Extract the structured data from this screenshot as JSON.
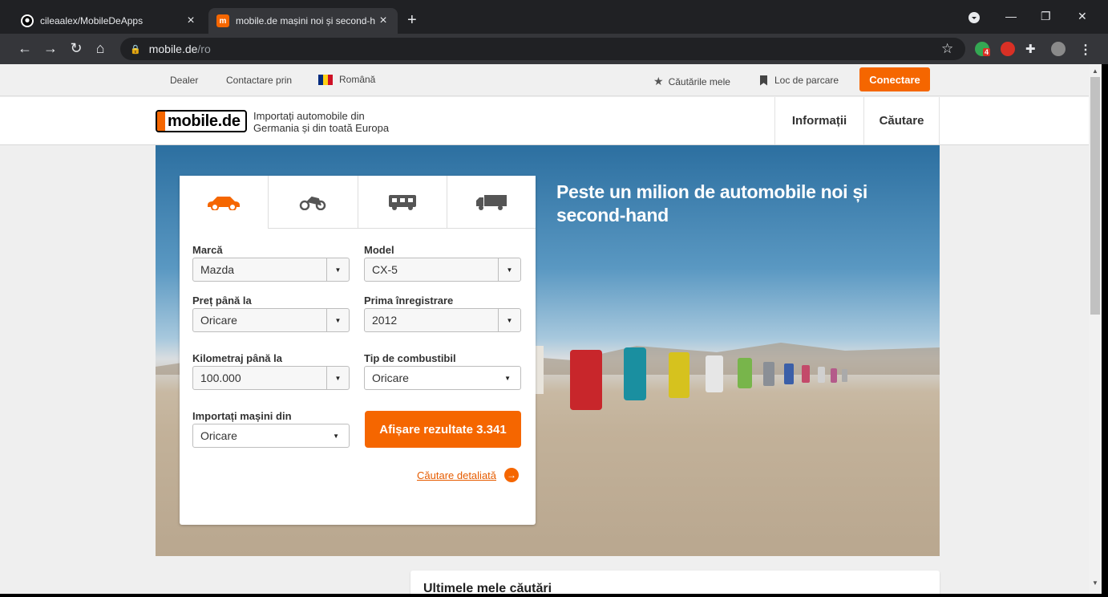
{
  "browser": {
    "tabs": [
      {
        "title": "cileaalex/MobileDeApps",
        "active": false
      },
      {
        "title": "mobile.de mașini noi și second-h",
        "active": true
      }
    ],
    "url_host": "mobile.de",
    "url_path": "/ro",
    "extension_badge": "4"
  },
  "utility_bar": {
    "dealer": "Dealer",
    "contact": "Contactare prin",
    "language": "Română",
    "saved_searches": "Căutările mele",
    "parking": "Loc de parcare",
    "login": "Conectare"
  },
  "header": {
    "logo": "mobile.de",
    "tagline_line1": "Importați automobile din",
    "tagline_line2": "Germania și din toată Europa",
    "nav_info": "Informații",
    "nav_search": "Căutare"
  },
  "hero": {
    "title_line1": "Peste un milion de automobile noi și",
    "title_line2": "second-hand"
  },
  "search_form": {
    "make_label": "Marcă",
    "make_value": "Mazda",
    "model_label": "Model",
    "model_value": "CX-5",
    "price_label": "Preț până la",
    "price_value": "Oricare",
    "reg_label": "Prima înregistrare",
    "reg_value": "2012",
    "mileage_label": "Kilometraj până la",
    "mileage_value": "100.000",
    "fuel_label": "Tip de combustibil",
    "fuel_value": "Oricare",
    "import_label": "Importați mașini din",
    "import_value": "Oricare",
    "submit": "Afișare rezultate 3.341",
    "advanced": "Căutare detaliată"
  },
  "recent_searches": {
    "title": "Ultimele mele căutări"
  },
  "colors": {
    "accent": "#f56600"
  }
}
